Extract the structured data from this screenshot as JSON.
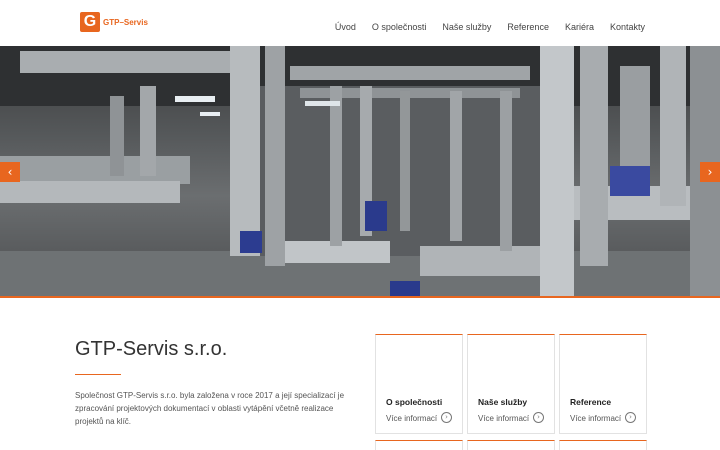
{
  "header": {
    "logo_letter": "G",
    "logo_text": "GTP–Servis",
    "nav": [
      {
        "label": "Úvod"
      },
      {
        "label": "O společnosti"
      },
      {
        "label": "Naše služby"
      },
      {
        "label": "Reference"
      },
      {
        "label": "Kariéra"
      },
      {
        "label": "Kontakty"
      }
    ]
  },
  "hero": {
    "prev_arrow": "‹",
    "next_arrow": "›"
  },
  "main": {
    "title": "GTP-Servis s.r.o.",
    "intro": "Společnost GTP-Servis s.r.o. byla založena v roce 2017 a její specializací je zpracování projektových dokumentací v oblasti vytápění včetně realizace projektů na klíč.",
    "cards": [
      {
        "title": "O společnosti",
        "link": "Více informací",
        "icon": "arrow-circle-icon"
      },
      {
        "title": "Naše služby",
        "link": "Více informací",
        "icon": "arrow-circle-icon"
      },
      {
        "title": "Reference",
        "link": "Více informací",
        "icon": "arrow-circle-icon"
      }
    ]
  },
  "colors": {
    "accent": "#e8661f"
  }
}
